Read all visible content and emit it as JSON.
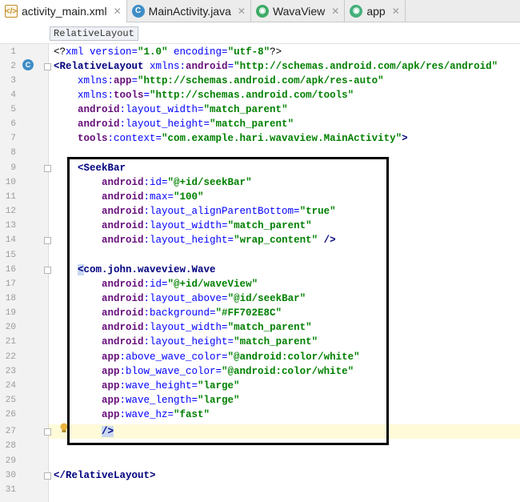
{
  "tabs": [
    {
      "label": "activity_main.xml",
      "icon": "xml-file-icon"
    },
    {
      "label": "MainActivity.java",
      "icon": "class-icon"
    },
    {
      "label": "WavaView",
      "icon": "android-run-config-icon"
    },
    {
      "label": "app",
      "icon": "android-module-icon"
    }
  ],
  "breadcrumb": "RelativeLayout",
  "line_numbers": [
    "1",
    "2",
    "3",
    "4",
    "5",
    "6",
    "7",
    "8",
    "9",
    "10",
    "11",
    "12",
    "13",
    "14",
    "15",
    "16",
    "17",
    "18",
    "19",
    "20",
    "21",
    "22",
    "23",
    "24",
    "25",
    "26",
    "27",
    "28",
    "29",
    "30",
    "31"
  ],
  "code": {
    "l1a": "<?",
    "l1b": "xml version=",
    "l1c": "\"1.0\"",
    "l1d": " encoding=",
    "l1e": "\"utf-8\"",
    "l1f": "?>",
    "l2a": "<RelativeLayout ",
    "l2b": "xmlns:",
    "l2c": "android",
    "l2d": "=",
    "l2e": "\"http://schemas.android.com/apk/res/android\"",
    "l3a": "    xmlns:",
    "l3b": "app",
    "l3c": "=",
    "l3d": "\"http://schemas.android.com/apk/res-auto\"",
    "l4a": "    xmlns:",
    "l4b": "tools",
    "l4c": "=",
    "l4d": "\"http://schemas.android.com/tools\"",
    "l5a": "    android",
    "l5b": ":layout_width=",
    "l5c": "\"match_parent\"",
    "l6a": "    android",
    "l6b": ":layout_height=",
    "l6c": "\"match_parent\"",
    "l7a": "    tools",
    "l7b": ":context=",
    "l7c": "\"com.example.hari.wavaview.MainActivity\"",
    "l7d": ">",
    "l9a": "    <SeekBar",
    "l10a": "        android",
    "l10b": ":id=",
    "l10c": "\"@+id/seekBar\"",
    "l11a": "        android",
    "l11b": ":max=",
    "l11c": "\"100\"",
    "l12a": "        android",
    "l12b": ":layout_alignParentBottom=",
    "l12c": "\"true\"",
    "l13a": "        android",
    "l13b": ":layout_width=",
    "l13c": "\"match_parent\"",
    "l14a": "        android",
    "l14b": ":layout_height=",
    "l14c": "\"wrap_content\"",
    "l14d": " />",
    "l16a": "<",
    "l16b": "com.john.waveview.Wave",
    "l17a": "        android",
    "l17b": ":id=",
    "l17c": "\"@+id/waveView\"",
    "l18a": "        android",
    "l18b": ":layout_above=",
    "l18c": "\"@id/seekBar\"",
    "l19a": "        android",
    "l19b": ":background=",
    "l19c": "\"#FF702E8C\"",
    "l20a": "        android",
    "l20b": ":layout_width=",
    "l20c": "\"match_parent\"",
    "l21a": "        android",
    "l21b": ":layout_height=",
    "l21c": "\"match_parent\"",
    "l22a": "        app",
    "l22b": ":above_wave_color=",
    "l22c": "\"@android:color/white\"",
    "l23a": "        app",
    "l23b": ":blow_wave_color=",
    "l23c": "\"@android:color/white\"",
    "l24a": "        app",
    "l24b": ":wave_height=",
    "l24c": "\"large\"",
    "l25a": "        app",
    "l25b": ":wave_length=",
    "l25c": "\"large\"",
    "l26a": "        app",
    "l26b": ":wave_hz=",
    "l26c": "\"fast\"",
    "l27a": "/>",
    "l30a": "</RelativeLayout>"
  },
  "colors": {
    "tag": "#00007f",
    "namespace": "#660e7a",
    "value": "#008000",
    "caret_line": "#fffbd9"
  }
}
